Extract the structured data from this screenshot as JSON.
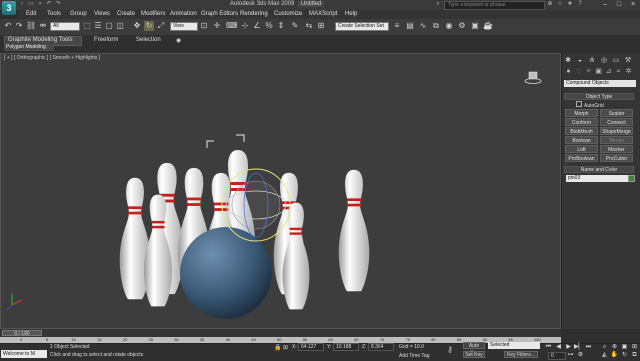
{
  "app": {
    "title": "Autodesk 3ds Max 2009",
    "file": "Untitled",
    "search_placeholder": "Type a keyword or phrase",
    "logo_letter": "3"
  },
  "menu": [
    "Edit",
    "Tools",
    "Group",
    "Views",
    "Create",
    "Modifiers",
    "Animation",
    "Graph Editors",
    "Rendering",
    "Customize",
    "MAXScript",
    "Help"
  ],
  "toolbar": {
    "selection_filter": "All",
    "reference_coord": "View",
    "named_selection": "Create Selection Set"
  },
  "ribbon": {
    "tabs": [
      "Graphite Modeling Tools",
      "Freeform",
      "Selection"
    ],
    "active_panel": "Polygon Modeling"
  },
  "viewport": {
    "label": "[ + ] [ Orthographic ] [ Smooth + Highlights ]",
    "colors": {
      "background": "#3d3d3d",
      "ball": "#3b5a78",
      "pin": "#efefef",
      "stripe": "#c81e1e",
      "gizmo": "#e6e67a"
    }
  },
  "command_panel": {
    "category": "Compound Objects",
    "object_type_title": "Object Type",
    "autogrid_label": "AutoGrid",
    "buttons": [
      "Morph",
      "Scatter",
      "Conform",
      "Connect",
      "BlobMesh",
      "ShapeMerge",
      "Boolean",
      "Terrain",
      "Loft",
      "Mesher",
      "ProBoolean",
      "ProCutter"
    ],
    "name_color_title": "Name and Color",
    "object_name": "pin03",
    "object_color": "#3c8a2e"
  },
  "timeline": {
    "frame_display": "0 / 100",
    "ticks": [
      "0",
      "5",
      "10",
      "15",
      "20",
      "25",
      "30",
      "35",
      "40",
      "45",
      "50",
      "55",
      "60",
      "65",
      "70",
      "75",
      "80",
      "85",
      "90",
      "95",
      "100"
    ]
  },
  "status": {
    "maxscript_text": "Welcome to M",
    "objects_selected": "1 Object Selected",
    "prompt": "Click and drag to select and rotate objects",
    "x_label": "X:",
    "x_value": "64.127",
    "y_label": "Y:",
    "y_value": "10.188",
    "z_label": "Z:",
    "z_value": "8.364",
    "grid": "Grid = 10.0",
    "auto_key": "Auto Key",
    "set_key": "Set Key",
    "selected_dropdown": "Selected",
    "key_filters": "Key Filters...",
    "add_time_tag": "Add Time Tag",
    "current_frame": "0"
  }
}
